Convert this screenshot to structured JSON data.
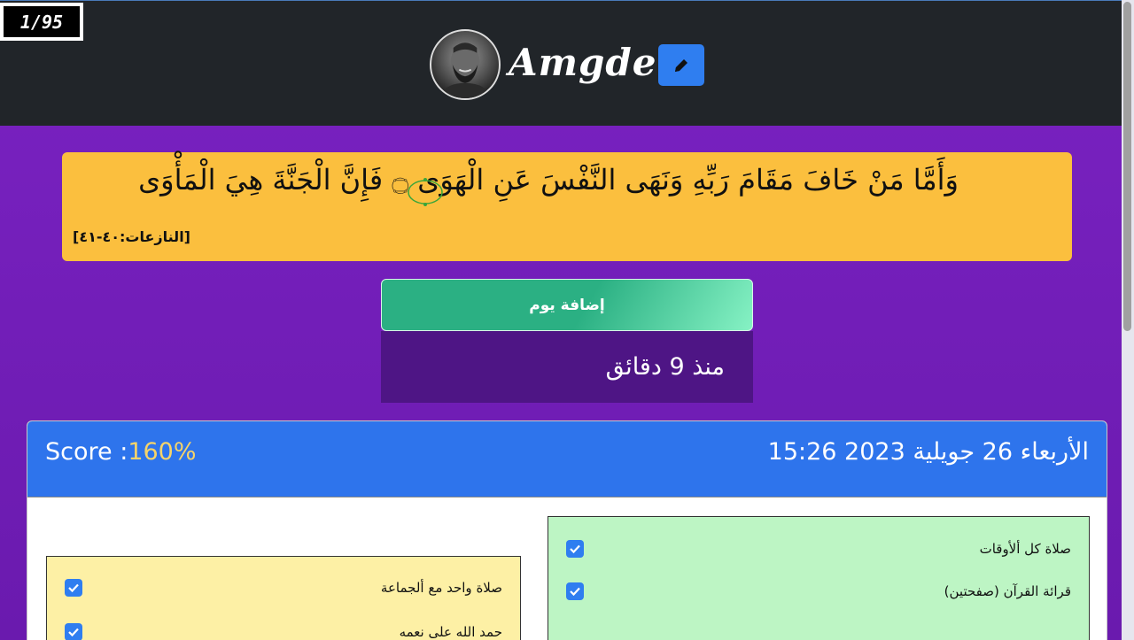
{
  "header": {
    "counter": "1/95",
    "username": "Amgde"
  },
  "verse": {
    "text": "وَأَمَّا مَنْ خَافَ مَقَامَ رَبِّهِ وَنَهَى النَّفْسَ عَنِ الْهَوَى ۝ فَإِنَّ الْجَنَّةَ هِيَ الْمَأْوَى",
    "reference": "[النازعات:٤٠-٤١]"
  },
  "actions": {
    "add_day_label": "إضافة يوم",
    "since_label": "منذ 9 دقائق"
  },
  "card": {
    "score_prefix": "Score :",
    "score_value": "160%",
    "date": "الأربعاء 26 جويلية 2023 15:26"
  },
  "tasks": {
    "green": [
      {
        "label": "صلاة كل ألأوقات",
        "checked": true
      },
      {
        "label": "قرائة القرآن (صفحتين)",
        "checked": true
      }
    ],
    "yellow": [
      {
        "label": "صلاة واحد مع ألجماعة",
        "checked": true
      },
      {
        "label": "حمد الله على نعمه",
        "checked": true
      }
    ]
  },
  "colors": {
    "header_bg": "#212529",
    "page_bg": "#7a22c2",
    "verse_bg": "#fbbf3e",
    "add_day_bg": "#2bb083",
    "since_bg": "#4e1585",
    "card_head_bg": "#2e74ec",
    "score_value": "#f6d46a",
    "green_panel": "#bdf5c4",
    "yellow_panel": "#fdf0a5",
    "checkbox": "#2f7ef0"
  },
  "icons": {
    "edit": "pencil-icon",
    "check": "check-icon",
    "verse_separator": "ayah-end-icon"
  }
}
